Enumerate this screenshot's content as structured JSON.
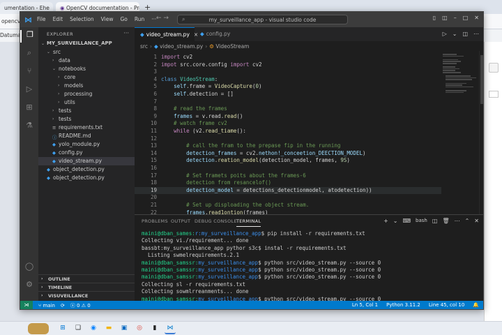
{
  "browser": {
    "tab1": "umentation - Ehe",
    "tab2": "OpenCV documentation - Prod",
    "plus": "+",
    "url_fragment": "opencv",
    "bar2_fragment": "Datuman"
  },
  "window": {
    "menu": [
      "File",
      "Edit",
      "Selection",
      "View",
      "Go",
      "Run"
    ],
    "more": "···",
    "title": "my_surveillance_app - visual studio code"
  },
  "sidebar": {
    "header": "EXPLORER",
    "more": "···",
    "root": "MY_SURVEILLANCE_APP",
    "items": [
      {
        "label": "src",
        "kind": "folder-open",
        "depth": 1
      },
      {
        "label": "data",
        "kind": "folder",
        "depth": 2
      },
      {
        "label": "notebooks",
        "kind": "folder-open",
        "depth": 2
      },
      {
        "label": "core",
        "kind": "folder",
        "depth": 3
      },
      {
        "label": "models",
        "kind": "folder",
        "depth": 3
      },
      {
        "label": "processing",
        "kind": "folder",
        "depth": 3
      },
      {
        "label": "utils",
        "kind": "folder",
        "depth": 3
      },
      {
        "label": "tests",
        "kind": "folder",
        "depth": 2
      },
      {
        "label": "tests",
        "kind": "folder",
        "depth": 2
      },
      {
        "label": "requirements.txt",
        "kind": "txt",
        "depth": 2
      },
      {
        "label": "README.md",
        "kind": "md",
        "depth": 2
      },
      {
        "label": "yolo_module.py",
        "kind": "py",
        "depth": 2
      },
      {
        "label": "config.py",
        "kind": "py",
        "depth": 2
      },
      {
        "label": "video_stream.py",
        "kind": "py",
        "depth": 2,
        "selected": true
      },
      {
        "label": "object_detection.py",
        "kind": "py",
        "depth": 1
      },
      {
        "label": "object_detection.py",
        "kind": "py",
        "depth": 1
      }
    ],
    "sections": [
      "OUTLINE",
      "TIMELINE",
      "VISUVEILLANCE"
    ]
  },
  "tabs": [
    {
      "label": "video_stream.py",
      "active": true,
      "close": "×"
    },
    {
      "label": "config.py",
      "active": false
    }
  ],
  "breadcrumb": [
    "src",
    "video_stream.py",
    "VideoStream"
  ],
  "code": {
    "current_line": 19,
    "lines": [
      [
        [
          "import",
          "k"
        ],
        [
          " cv2",
          ""
        ]
      ],
      [
        [
          "impot",
          "k"
        ],
        [
          " src.core.config ",
          ""
        ],
        [
          "import",
          "k"
        ],
        [
          " cv2",
          ""
        ]
      ],
      [],
      [
        [
          "class",
          "kw"
        ],
        [
          " ",
          ""
        ],
        [
          "VideoStream",
          "cls"
        ],
        [
          ":",
          ""
        ]
      ],
      [
        [
          "    ",
          ""
        ],
        [
          "self",
          "vr"
        ],
        [
          ".frame = ",
          ""
        ],
        [
          "VideoCapture",
          "fn"
        ],
        [
          "(",
          ""
        ],
        [
          "0",
          "nm"
        ],
        [
          ")",
          ""
        ]
      ],
      [
        [
          "    ",
          ""
        ],
        [
          "self",
          "vr"
        ],
        [
          ".detection = []",
          ""
        ]
      ],
      [],
      [
        [
          "    # read the frames",
          "cm"
        ]
      ],
      [
        [
          "    ",
          ""
        ],
        [
          "frames",
          "vr"
        ],
        [
          " = v.read.",
          ""
        ],
        [
          "read",
          "fn"
        ],
        [
          "()",
          ""
        ]
      ],
      [
        [
          "    # watch frame cv2",
          "cm"
        ]
      ],
      [
        [
          "    ",
          ""
        ],
        [
          "while",
          "k"
        ],
        [
          " (v2.",
          ""
        ],
        [
          "read_tiame",
          "fn"
        ],
        [
          "():",
          ""
        ]
      ],
      [],
      [
        [
          "        # call the fram to the prepase fip in the running",
          "cm"
        ]
      ],
      [
        [
          "        ",
          ""
        ],
        [
          "detection_frames",
          "vr"
        ],
        [
          " = cv2.",
          ""
        ],
        [
          "nethon!_conceetion_DEECTION_MODEL",
          "vr"
        ],
        [
          ")",
          ""
        ]
      ],
      [
        [
          "        ",
          ""
        ],
        [
          "detection",
          "vr"
        ],
        [
          ".",
          ""
        ],
        [
          "reation_model",
          "fn"
        ],
        [
          "(detection_model, frames, ",
          ""
        ],
        [
          "9S",
          "nm"
        ],
        [
          ")",
          ""
        ]
      ],
      [],
      [
        [
          "        # Set framets poits about the frames-6",
          "cm"
        ]
      ],
      [
        [
          "        detection from resancelof()",
          "cm"
        ]
      ],
      [
        [
          "        ",
          ""
        ],
        [
          "detection_model",
          "vr"
        ],
        [
          " = detections_detectionmodel, atodetection))",
          ""
        ]
      ],
      [],
      [
        [
          "        # Set up disploading the object stream.",
          "cm"
        ]
      ],
      [
        [
          "        ",
          ""
        ],
        [
          "frames",
          "vr"
        ],
        [
          ".",
          ""
        ],
        [
          "read1ontion",
          "fn"
        ],
        [
          "(frames)",
          ""
        ]
      ]
    ]
  },
  "panel": {
    "tabs": [
      "PROBLEMS",
      "OUTPUT",
      "DEBUG CONSOLE",
      "TERMINAL"
    ],
    "active": "TERMINAL",
    "shell": "bash",
    "lines": [
      {
        "user": "maini@dban_sames",
        "path": "r:my_surveillance_app",
        "cmd": "$ pip install -r requirements.txt"
      },
      {
        "text": "Collecting vi./requirement... done"
      },
      {
        "text": "bassbt:my_surveillance_app pythor s3c$ instal -r requirements.txt"
      },
      {
        "text": "  Listing swmelrequirements.2.1"
      },
      {
        "user": "maini@dban_samssr",
        "path": "my_surveillance_app",
        "cmd": "$ python src/video_stream.py --source 0"
      },
      {
        "user": "maini@dban_samssr",
        "path": "my_surveillance_app",
        "cmd": "$ python src/video_stream.py --source 0"
      },
      {
        "user": "maini@dban_samssr",
        "path": "my_surveillance_app",
        "cmd": "$ python src/video_stream.py --source 0"
      },
      {
        "text": "Collecting sl -r requirements.txt"
      },
      {
        "text": "Collecting sowmlrreanments... done"
      },
      {
        "user": "maini@dban_samssr",
        "path": "my_surveillance_app",
        "cmd": "$ python src/video_stream.py --source 0"
      }
    ]
  },
  "status": {
    "branch": "main",
    "problems": "ⓧ 0 ⚠ 0",
    "position": "Ln 5, Col 1",
    "language": "Python 3.11.2",
    "position2": "Line 45, col 10"
  }
}
